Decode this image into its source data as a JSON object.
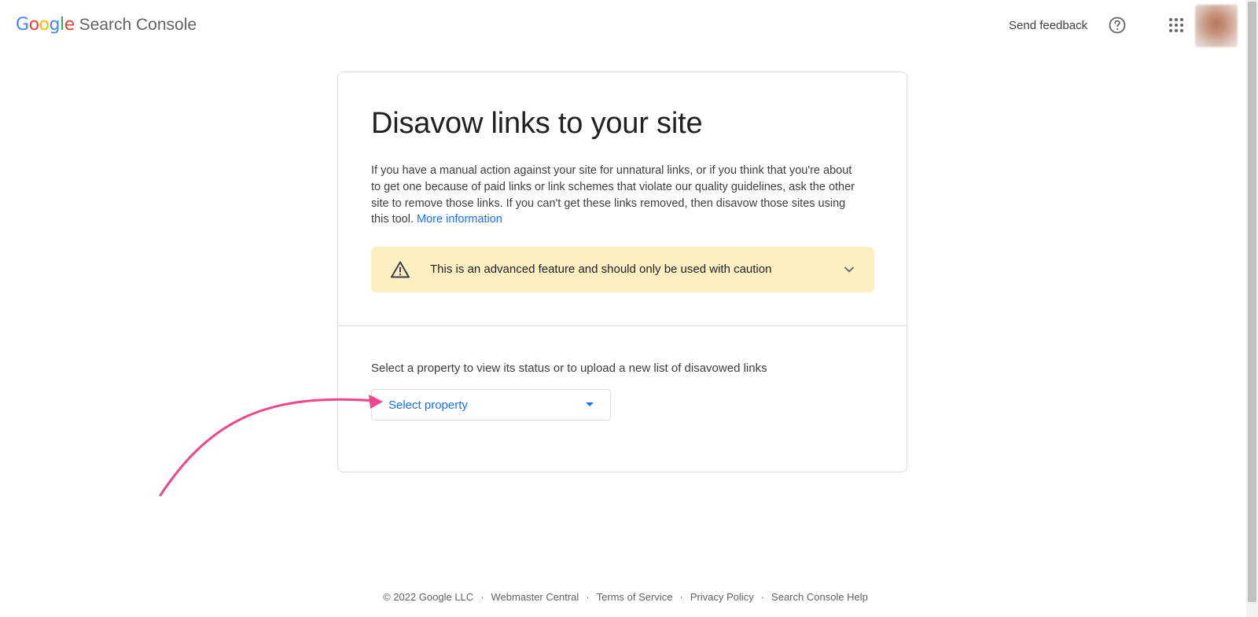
{
  "header": {
    "logo_letters": [
      {
        "char": "G",
        "color": "#4285F4"
      },
      {
        "char": "o",
        "color": "#EA4335"
      },
      {
        "char": "o",
        "color": "#FBBC05"
      },
      {
        "char": "g",
        "color": "#4285F4"
      },
      {
        "char": "l",
        "color": "#34A853"
      },
      {
        "char": "e",
        "color": "#EA4335"
      }
    ],
    "logo_google": "Google",
    "logo_product": "Search Console",
    "send_feedback": "Send feedback",
    "help_icon": "help-circle-icon",
    "apps_icon": "apps-grid-icon"
  },
  "card": {
    "title": "Disavow links to your site",
    "description": "If you have a manual action against your site for unnatural links, or if you think that you're about to get one because of paid links or link schemes that violate our quality guidelines, ask the other site to remove those links. If you can't get these links removed, then disavow those sites using this tool.",
    "more_info_link": "More information",
    "caution": {
      "icon": "warning-triangle-icon",
      "text": "This is an advanced feature and should only be used with caution",
      "background": "#feefc3"
    },
    "select_label": "Select a property to view its status or to upload a new list of disavowed links",
    "select": {
      "value": "Select property",
      "color": "#1a73e8"
    }
  },
  "annotation": {
    "arrow_color": "#f0468a"
  },
  "footer": {
    "copyright": "© 2022 Google LLC",
    "links": [
      "Webmaster Central",
      "Terms of Service",
      "Privacy Policy",
      "Search Console Help"
    ],
    "separator": "·"
  },
  "colors": {
    "link": "#1a73e8",
    "text": "#202124",
    "border": "#dadce0"
  }
}
